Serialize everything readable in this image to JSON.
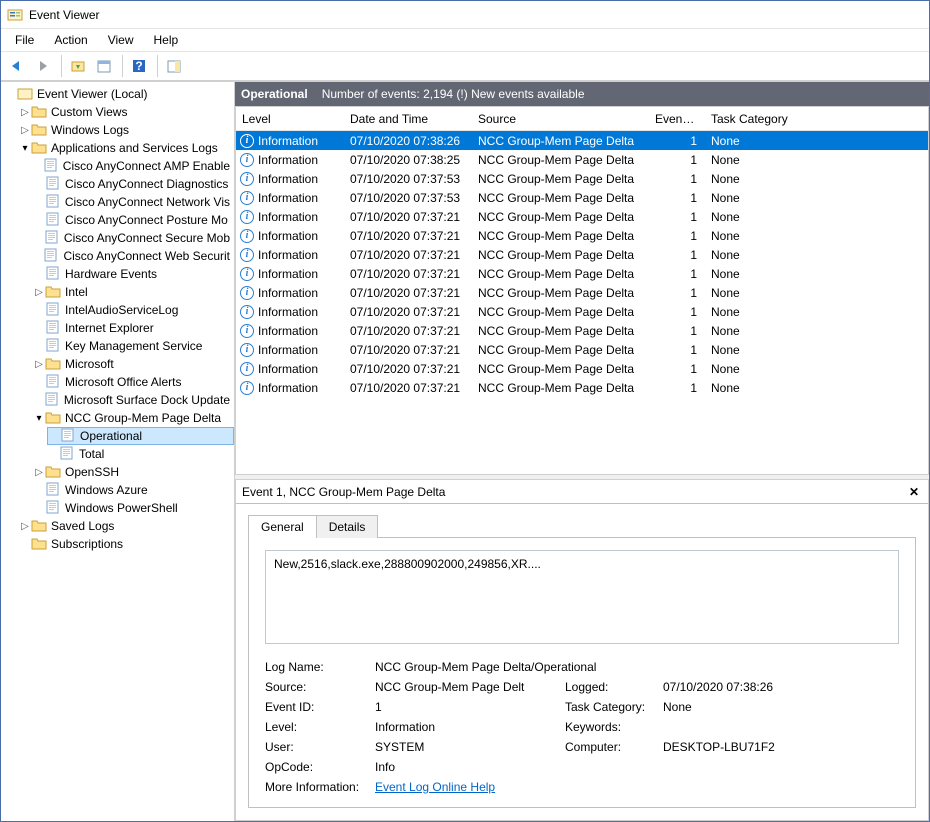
{
  "window": {
    "title": "Event Viewer"
  },
  "menubar": [
    "File",
    "Action",
    "View",
    "Help"
  ],
  "tree": {
    "root": "Event Viewer (Local)",
    "custom_views": "Custom Views",
    "windows_logs": "Windows Logs",
    "app_services": "Applications and Services Logs",
    "items": [
      "Cisco AnyConnect AMP Enable",
      "Cisco AnyConnect Diagnostics",
      "Cisco AnyConnect Network Vis",
      "Cisco AnyConnect Posture Mo",
      "Cisco AnyConnect Secure Mob",
      "Cisco AnyConnect Web Securit",
      "Hardware Events",
      "Intel",
      "IntelAudioServiceLog",
      "Internet Explorer",
      "Key Management Service",
      "Microsoft",
      "Microsoft Office Alerts",
      "Microsoft Surface Dock Update",
      "NCC Group-Mem Page Delta",
      "Operational",
      "Total",
      "OpenSSH",
      "Windows Azure",
      "Windows PowerShell"
    ],
    "saved_logs": "Saved Logs",
    "subscriptions": "Subscriptions"
  },
  "header": {
    "name": "Operational",
    "count_text": "Number of events: 2,194 (!) New events available"
  },
  "columns": {
    "level": "Level",
    "dt": "Date and Time",
    "src": "Source",
    "eid": "Event ID",
    "tcat": "Task Category"
  },
  "events": [
    {
      "level": "Information",
      "dt": "07/10/2020 07:38:26",
      "src": "NCC Group-Mem Page Delta",
      "eid": "1",
      "tcat": "None"
    },
    {
      "level": "Information",
      "dt": "07/10/2020 07:38:25",
      "src": "NCC Group-Mem Page Delta",
      "eid": "1",
      "tcat": "None"
    },
    {
      "level": "Information",
      "dt": "07/10/2020 07:37:53",
      "src": "NCC Group-Mem Page Delta",
      "eid": "1",
      "tcat": "None"
    },
    {
      "level": "Information",
      "dt": "07/10/2020 07:37:53",
      "src": "NCC Group-Mem Page Delta",
      "eid": "1",
      "tcat": "None"
    },
    {
      "level": "Information",
      "dt": "07/10/2020 07:37:21",
      "src": "NCC Group-Mem Page Delta",
      "eid": "1",
      "tcat": "None"
    },
    {
      "level": "Information",
      "dt": "07/10/2020 07:37:21",
      "src": "NCC Group-Mem Page Delta",
      "eid": "1",
      "tcat": "None"
    },
    {
      "level": "Information",
      "dt": "07/10/2020 07:37:21",
      "src": "NCC Group-Mem Page Delta",
      "eid": "1",
      "tcat": "None"
    },
    {
      "level": "Information",
      "dt": "07/10/2020 07:37:21",
      "src": "NCC Group-Mem Page Delta",
      "eid": "1",
      "tcat": "None"
    },
    {
      "level": "Information",
      "dt": "07/10/2020 07:37:21",
      "src": "NCC Group-Mem Page Delta",
      "eid": "1",
      "tcat": "None"
    },
    {
      "level": "Information",
      "dt": "07/10/2020 07:37:21",
      "src": "NCC Group-Mem Page Delta",
      "eid": "1",
      "tcat": "None"
    },
    {
      "level": "Information",
      "dt": "07/10/2020 07:37:21",
      "src": "NCC Group-Mem Page Delta",
      "eid": "1",
      "tcat": "None"
    },
    {
      "level": "Information",
      "dt": "07/10/2020 07:37:21",
      "src": "NCC Group-Mem Page Delta",
      "eid": "1",
      "tcat": "None"
    },
    {
      "level": "Information",
      "dt": "07/10/2020 07:37:21",
      "src": "NCC Group-Mem Page Delta",
      "eid": "1",
      "tcat": "None"
    },
    {
      "level": "Information",
      "dt": "07/10/2020 07:37:21",
      "src": "NCC Group-Mem Page Delta",
      "eid": "1",
      "tcat": "None"
    }
  ],
  "details": {
    "title": "Event 1, NCC Group-Mem Page Delta",
    "tabs": {
      "general": "General",
      "details": "Details"
    },
    "message": "New,2516,slack.exe,288800902000,249856,XR....",
    "labels": {
      "logname": "Log Name:",
      "source": "Source:",
      "eventid": "Event ID:",
      "level": "Level:",
      "user": "User:",
      "opcode": "OpCode:",
      "logged": "Logged:",
      "tcat": "Task Category:",
      "keywords": "Keywords:",
      "computer": "Computer:",
      "more": "More Information:"
    },
    "values": {
      "logname": "NCC Group-Mem Page Delta/Operational",
      "source": "NCC Group-Mem Page Delt",
      "eventid": "1",
      "level": "Information",
      "user": "SYSTEM",
      "opcode": "Info",
      "logged": "07/10/2020 07:38:26",
      "tcat": "None",
      "keywords": "",
      "computer": "DESKTOP-LBU71F2",
      "more_link": "Event Log Online Help"
    }
  }
}
